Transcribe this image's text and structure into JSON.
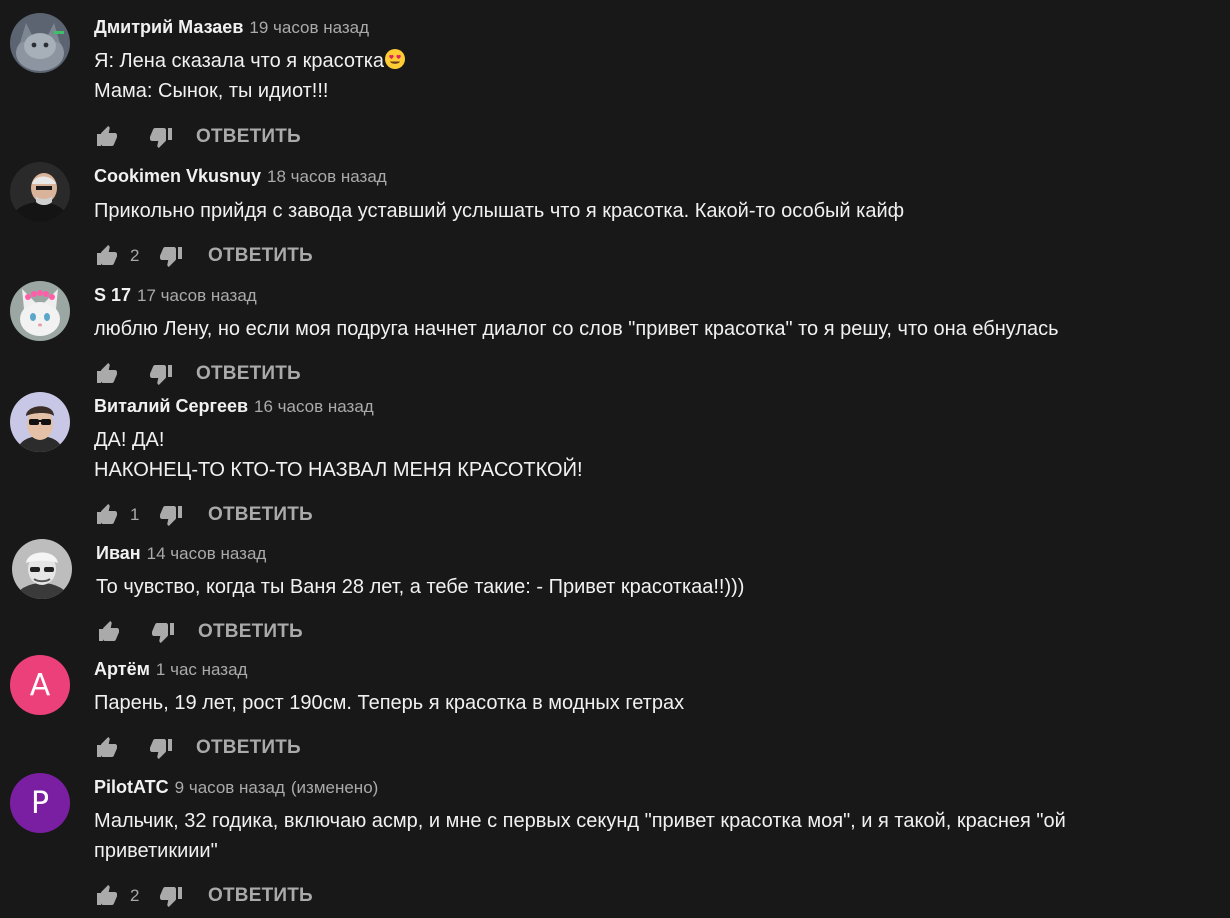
{
  "comments": [
    {
      "author": "Дмитрий Мазаев",
      "time": "19 часов назад",
      "edited": "",
      "text": "Я: Лена сказала что я красотка",
      "text_emoji": "heart-eyes-emoji",
      "text2": "Мама: Сынок, ты идиот!!!",
      "likes": "",
      "reply": "ОТВЕТИТЬ",
      "avatar": {
        "type": "image",
        "icon": "cat-avatar"
      }
    },
    {
      "author": "Cookimen Vkusnuy",
      "time": "18 часов назад",
      "edited": "",
      "text": "Прикольно прийдя с завода уставший услышать что я красотка. Какой-то особый кайф",
      "text2": "",
      "likes": "2",
      "reply": "ОТВЕТИТЬ",
      "avatar": {
        "type": "image",
        "icon": "man-avatar"
      }
    },
    {
      "author": "S 17",
      "time": "17 часов назад",
      "edited": "",
      "text": "люблю Лену, но если моя подруга начнет диалог со слов \"привет красотка\" то я решу, что она ебнулась",
      "text2": "",
      "likes": "",
      "reply": "ОТВЕТИТЬ",
      "avatar": {
        "type": "image",
        "icon": "kitten-avatar"
      }
    },
    {
      "author": "Виталий Сергеев",
      "time": "16 часов назад",
      "edited": "",
      "text": "ДА! ДА!",
      "text2": "НАКОНЕЦ-ТО КТО-ТО НАЗВАЛ МЕНЯ КРАСОТКОЙ!",
      "likes": "1",
      "reply": "ОТВЕТИТЬ",
      "avatar": {
        "type": "image",
        "icon": "sunglasses-avatar"
      }
    },
    {
      "author": "Иван",
      "time": "14 часов назад",
      "edited": "",
      "text": "То чувство, когда ты Ваня 28 лет, а тебе такие: - Привет красоткаа!!)))",
      "text2": "",
      "likes": "",
      "reply": "ОТВЕТИТЬ",
      "avatar": {
        "type": "image",
        "icon": "bw-portrait-avatar"
      }
    },
    {
      "author": "Артём",
      "time": "1 час назад",
      "edited": "",
      "text": "Парень, 19 лет, рост 190см. Теперь я красотка в модных гетрах",
      "text2": "",
      "likes": "",
      "reply": "ОТВЕТИТЬ",
      "avatar": {
        "type": "letter",
        "letter": "A",
        "color": "#ec407a"
      }
    },
    {
      "author": "PilotATC",
      "time": "9 часов назад",
      "edited": "(изменено)",
      "text": "Мальчик, 32 годика, включаю асмр, и мне с первых секунд \"привет красотка моя\", и я такой, краснея \"ой",
      "text2": "приветикиии\"",
      "likes": "2",
      "reply": "ОТВЕТИТЬ",
      "avatar": {
        "type": "letter",
        "letter": "P",
        "color": "#7b1fa2"
      }
    }
  ],
  "colors": {
    "background": "#181818",
    "text": "#f1f1f1",
    "secondary": "#aaaaaa"
  }
}
